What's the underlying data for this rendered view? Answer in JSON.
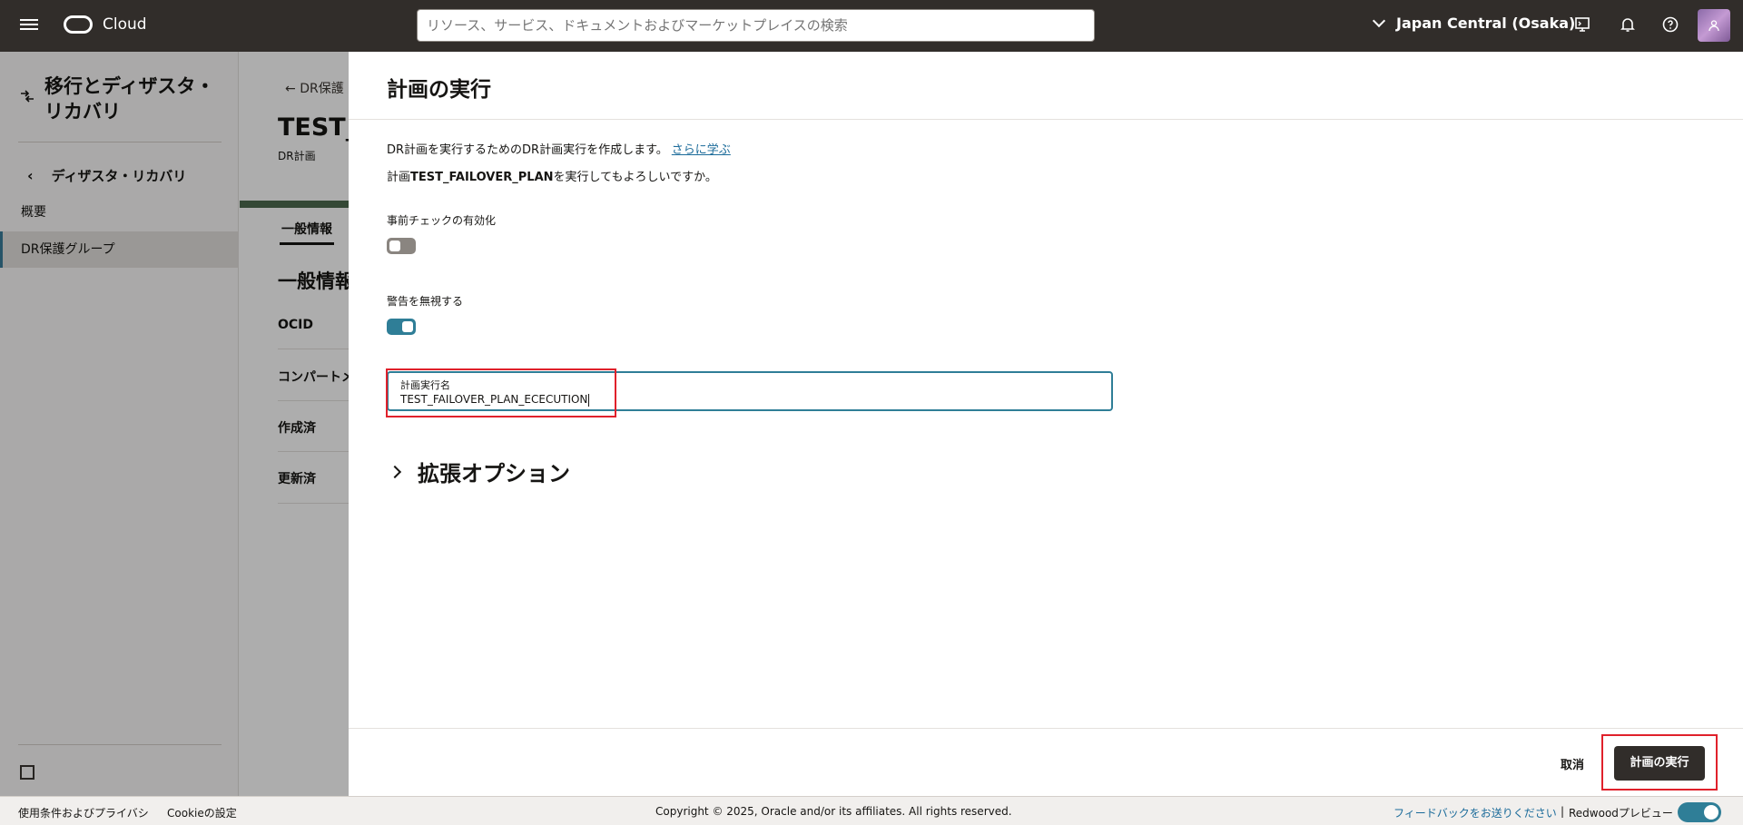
{
  "topbar": {
    "brand": "Cloud",
    "search_placeholder": "リソース、サービス、ドキュメントおよびマーケットプレイスの検索",
    "region": "Japan Central (Osaka)"
  },
  "sidebar": {
    "title": "移行とディザスタ・リカバリ",
    "back_label": "ディザスタ・リカバリ",
    "items": [
      {
        "label": "概要"
      },
      {
        "label": "DR保護グループ"
      }
    ]
  },
  "background_page": {
    "back_link": "DR保護",
    "title": "TEST_F",
    "subtitle": "DR計画",
    "tab": "一般情報",
    "section": "一般情報",
    "fields": [
      "OCID",
      "コンパートメ",
      "作成済",
      "更新済"
    ]
  },
  "drawer": {
    "title": "計画の実行",
    "description": "DR計画を実行するためのDR計画実行を作成します。",
    "learn_more": "さらに学ぶ",
    "confirm_prefix": "計画",
    "confirm_plan": "TEST_FAILOVER_PLAN",
    "confirm_suffix": "を実行してもよろしいですか。",
    "precheck_label": "事前チェックの有効化",
    "precheck_enabled": false,
    "ignore_warnings_label": "警告を無視する",
    "ignore_warnings_enabled": true,
    "execution_name_label": "計画実行名",
    "execution_name_value": "TEST_FAILOVER_PLAN_ECECUTION",
    "advanced_options": "拡張オプション",
    "cancel_label": "取消",
    "submit_label": "計画の実行"
  },
  "footer": {
    "terms": "使用条件およびプライバシ",
    "cookies": "Cookieの設定",
    "copyright": "Copyright © 2025, Oracle and/or its affiliates. All rights reserved.",
    "feedback": "フィードバックをお送りください",
    "separator": "|",
    "redwood": "Redwoodプレビュー"
  }
}
